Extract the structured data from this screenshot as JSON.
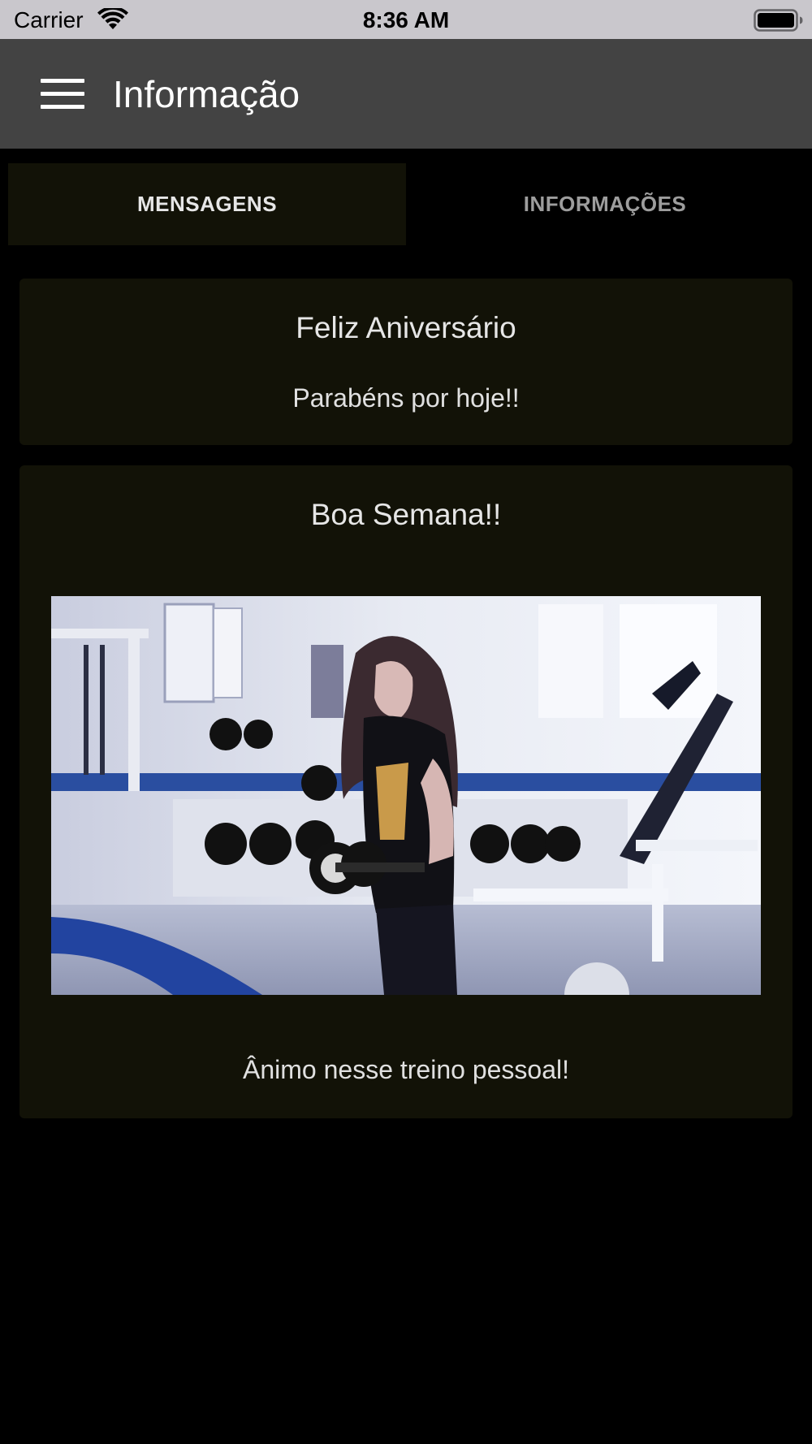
{
  "status_bar": {
    "carrier": "Carrier",
    "time": "8:36 AM",
    "wifi_icon": "wifi-icon",
    "battery_icon": "battery-full-icon"
  },
  "app_bar": {
    "menu_icon": "hamburger-menu-icon",
    "title": "Informação"
  },
  "tabs": [
    {
      "label": "MENSAGENS",
      "active": true
    },
    {
      "label": "INFORMAÇÕES",
      "active": false
    }
  ],
  "messages": [
    {
      "title": "Feliz Aniversário",
      "body": "Parabéns por hoje!!"
    },
    {
      "title": "Boa Semana!!",
      "image": "gym-woman-dumbbell-photo",
      "body": "Ânimo nesse treino pessoal!"
    }
  ],
  "colors": {
    "status_bar_bg": "#c9c7cc",
    "app_bar_bg": "#434343",
    "page_bg": "#000000",
    "card_bg": "#121207",
    "active_tab_bg": "#121207",
    "active_tab_text": "#e6e6e6",
    "inactive_tab_text": "#9d9d9d"
  }
}
